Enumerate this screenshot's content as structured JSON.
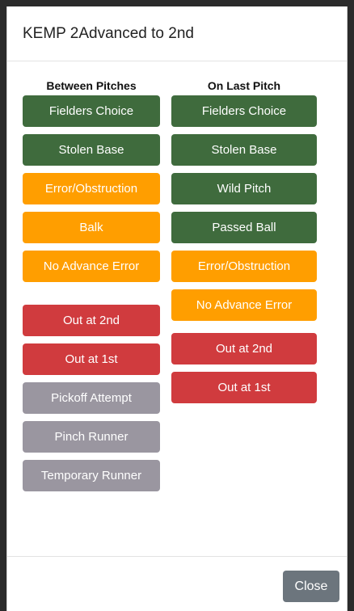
{
  "modal": {
    "title": "KEMP 2Advanced to 2nd",
    "close_label": "Close"
  },
  "left_column": {
    "heading": "Between Pitches",
    "buttons": [
      {
        "label": "Fielders Choice",
        "color": "#3f6b3d"
      },
      {
        "label": "Stolen Base",
        "color": "#3f6b3d"
      },
      {
        "label": "Error/Obstruction",
        "color": "#ff9e00"
      },
      {
        "label": "Balk",
        "color": "#ff9e00"
      },
      {
        "label": "No Advance Error",
        "color": "#ff9e00"
      }
    ],
    "outs": [
      {
        "label": "Out at 2nd",
        "color": "#d03b3e"
      },
      {
        "label": "Out at 1st",
        "color": "#d03b3e"
      }
    ],
    "other": [
      {
        "label": "Pickoff Attempt",
        "color": "#9a96a0"
      },
      {
        "label": "Pinch Runner",
        "color": "#9a96a0"
      },
      {
        "label": "Temporary Runner",
        "color": "#9a96a0"
      }
    ]
  },
  "right_column": {
    "heading": "On Last Pitch",
    "buttons": [
      {
        "label": "Fielders Choice",
        "color": "#3f6b3d"
      },
      {
        "label": "Stolen Base",
        "color": "#3f6b3d"
      },
      {
        "label": "Wild Pitch",
        "color": "#3f6b3d"
      },
      {
        "label": "Passed Ball",
        "color": "#3f6b3d"
      },
      {
        "label": "Error/Obstruction",
        "color": "#ff9e00"
      },
      {
        "label": "No Advance Error",
        "color": "#ff9e00"
      }
    ],
    "outs": [
      {
        "label": "Out at 2nd",
        "color": "#d03b3e"
      },
      {
        "label": "Out at 1st",
        "color": "#d03b3e"
      }
    ]
  }
}
